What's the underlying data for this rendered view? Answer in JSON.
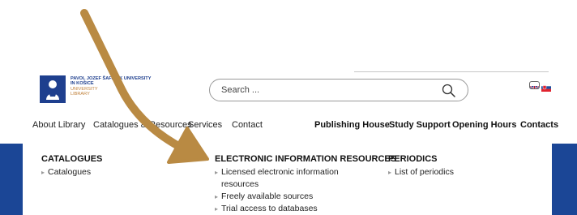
{
  "logo": {
    "line1": "PAVOL JOZEF ŠAFÁRIK UNIVERSITY",
    "line2": "IN KOŠICE",
    "line3": "UNIVERSITY",
    "line4": "LIBRARY"
  },
  "search": {
    "placeholder": "Search ..."
  },
  "nav": {
    "left": [
      "About Library",
      "Catalogues & Resources",
      "Services",
      "Contact"
    ],
    "right": [
      "Publishing House",
      "Study Support",
      "Opening Hours",
      "Contacts"
    ]
  },
  "dropdown": {
    "catalogues": {
      "heading": "CATALOGUES",
      "links": [
        "Catalogues"
      ]
    },
    "electronic": {
      "heading": "ELECTRONIC INFORMATION RESOURCES",
      "links": [
        "Licensed electronic information resources",
        "Freely available sources",
        "Trial access to databases"
      ]
    },
    "periodics": {
      "heading": "PERIODICS",
      "links": [
        "List of periodics"
      ]
    }
  },
  "colors": {
    "brand_blue": "#1b4696",
    "logo_gold": "#c0813a",
    "arrow": "#b98a43"
  },
  "icons": [
    "search-icon",
    "uk-flag-icon",
    "sk-flag-icon",
    "arrow-annotation"
  ]
}
